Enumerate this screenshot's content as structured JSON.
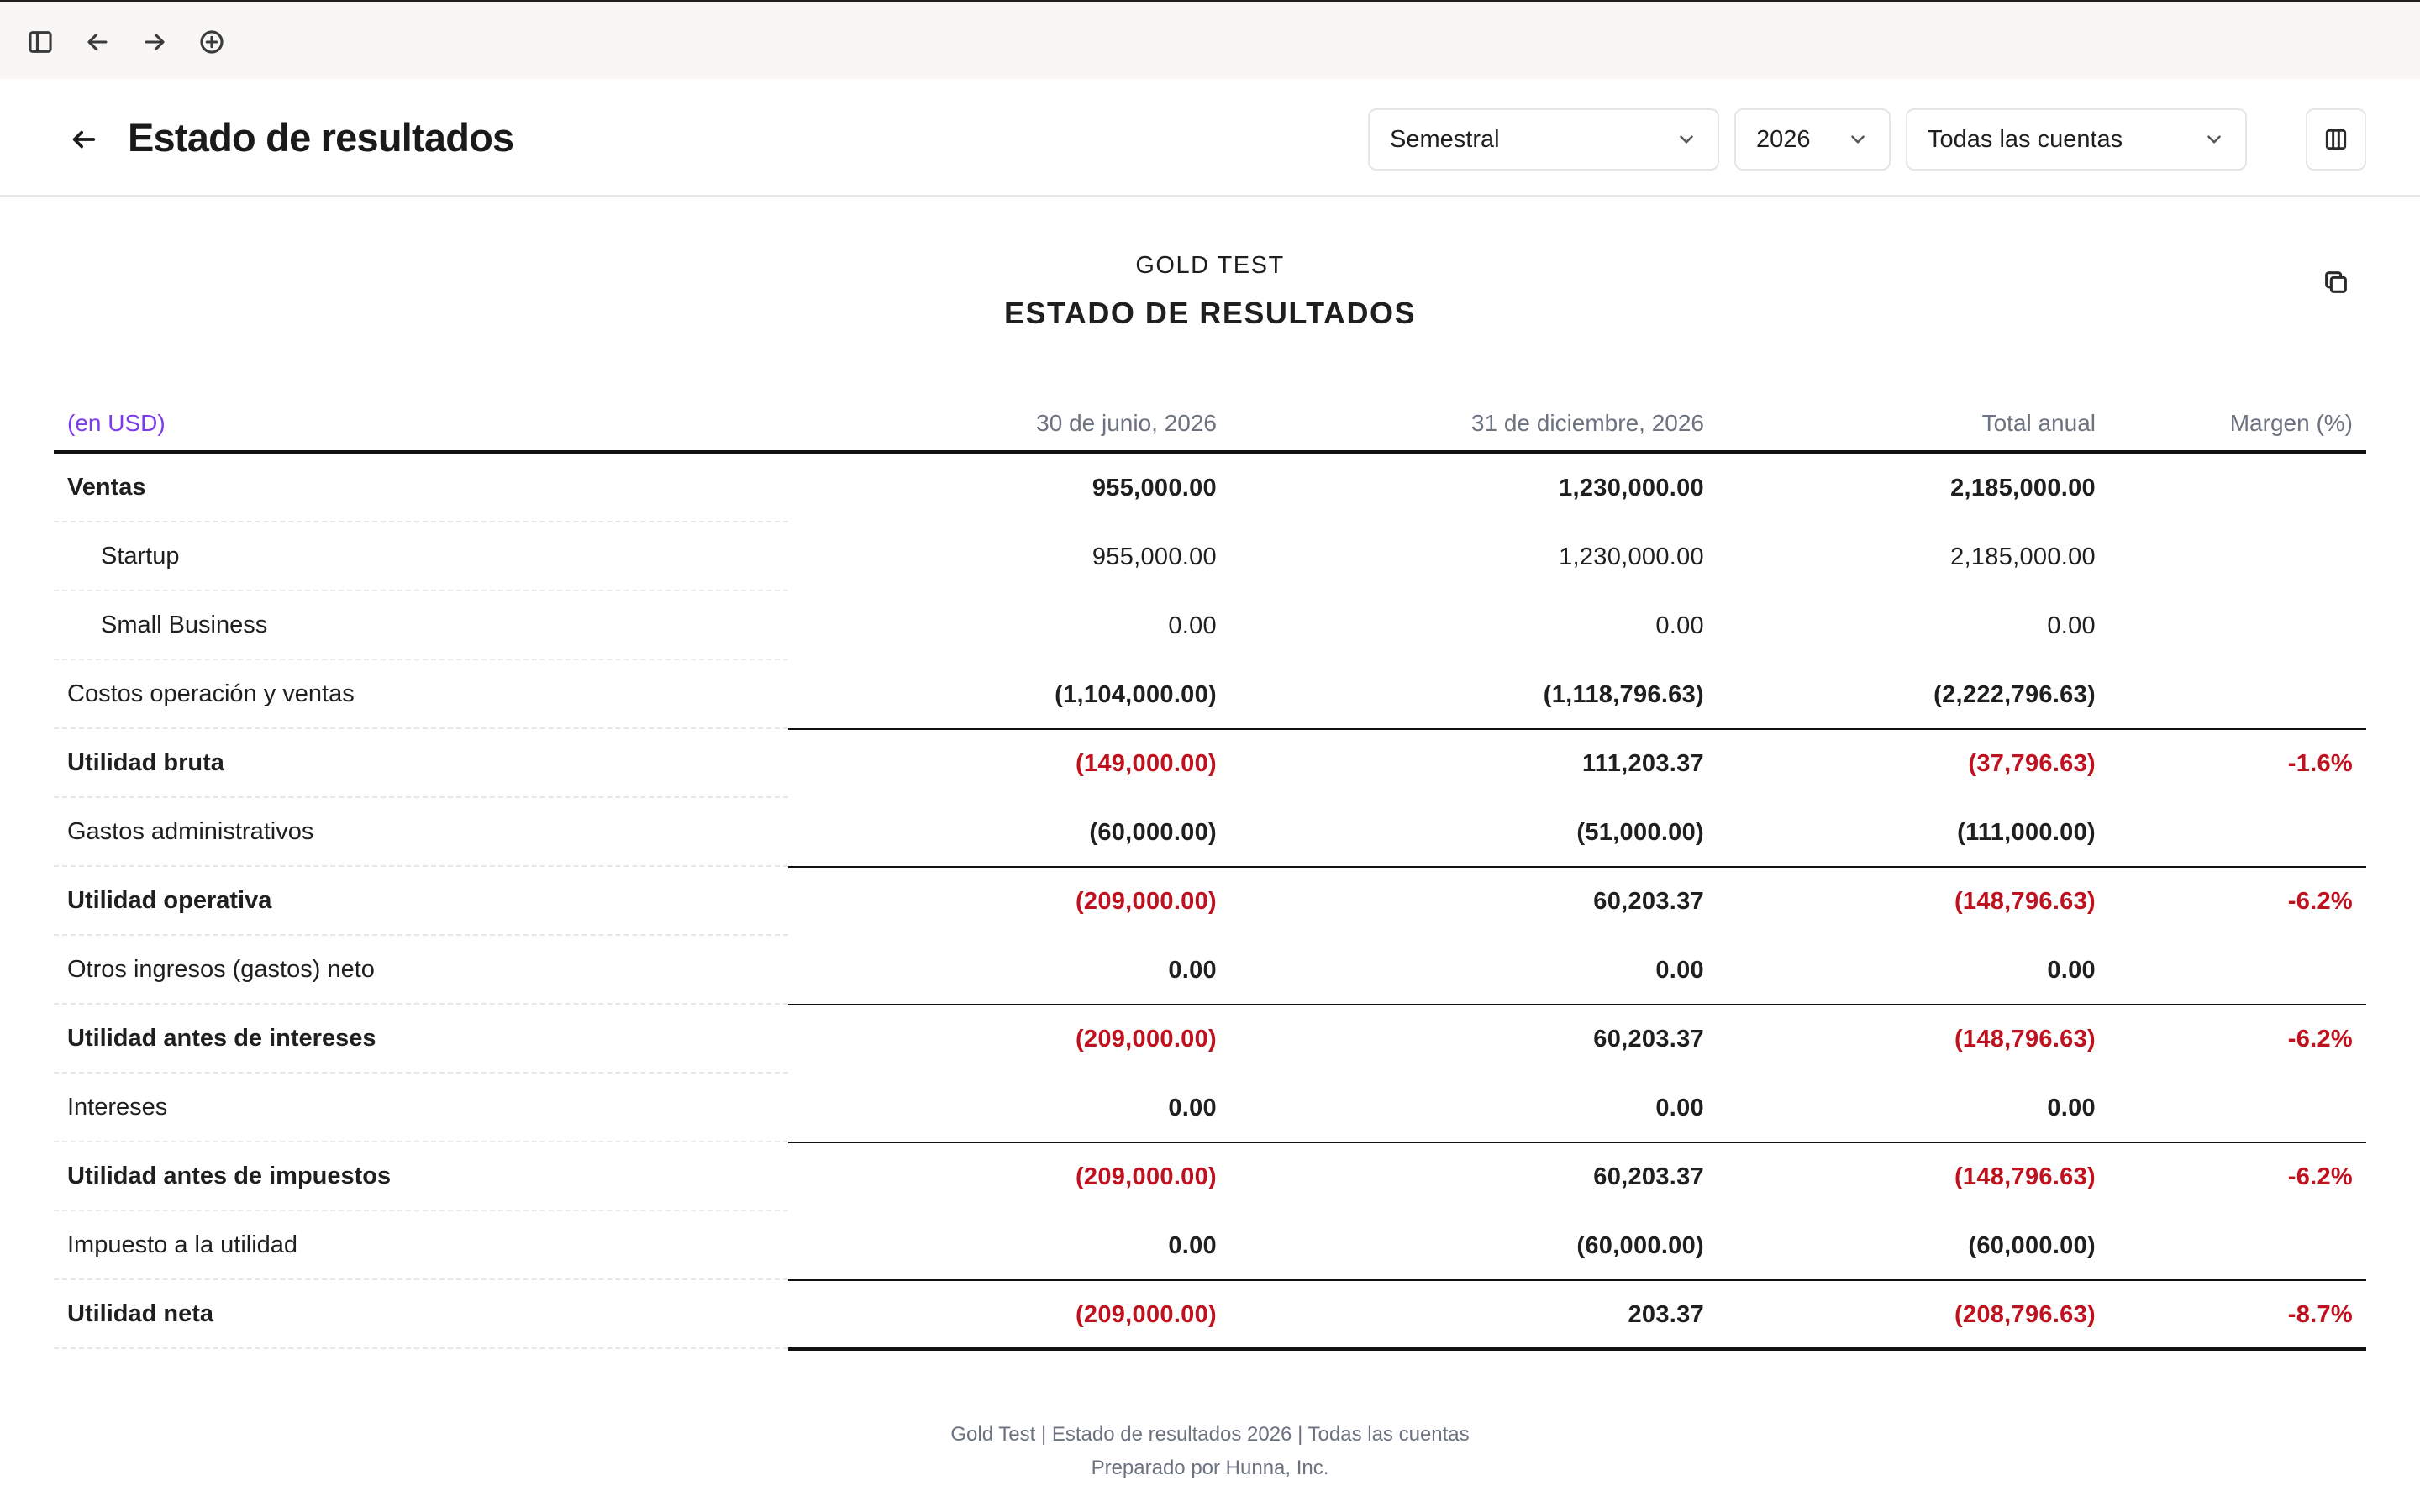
{
  "topbar": {
    "icons": [
      "sidebar-toggle-icon",
      "arrow-left-icon",
      "arrow-right-icon",
      "plus-circle-icon"
    ]
  },
  "header": {
    "title": "Estado de resultados",
    "period_select": "Semestral",
    "year_select": "2026",
    "accounts_select": "Todas las cuentas"
  },
  "report": {
    "company": "GOLD TEST",
    "title": "ESTADO DE RESULTADOS",
    "unit_label": "(en USD)",
    "columns": [
      "30 de junio, 2026",
      "31 de diciembre, 2026",
      "Total anual",
      "Margen (%)"
    ],
    "rows": [
      {
        "label": "Ventas",
        "values": [
          "955,000.00",
          "1,230,000.00",
          "2,185,000.00",
          ""
        ]
      },
      {
        "label": "Startup",
        "values": [
          "955,000.00",
          "1,230,000.00",
          "2,185,000.00",
          ""
        ]
      },
      {
        "label": "Small Business",
        "values": [
          "0.00",
          "0.00",
          "0.00",
          ""
        ]
      },
      {
        "label": "Costos operación y ventas",
        "values": [
          "(1,104,000.00)",
          "(1,118,796.63)",
          "(2,222,796.63)",
          ""
        ]
      },
      {
        "label": "Utilidad bruta",
        "values": [
          "(149,000.00)",
          "111,203.37",
          "(37,796.63)",
          "-1.6%"
        ]
      },
      {
        "label": "Gastos administrativos",
        "values": [
          "(60,000.00)",
          "(51,000.00)",
          "(111,000.00)",
          ""
        ]
      },
      {
        "label": "Utilidad operativa",
        "values": [
          "(209,000.00)",
          "60,203.37",
          "(148,796.63)",
          "-6.2%"
        ]
      },
      {
        "label": "Otros ingresos (gastos) neto",
        "values": [
          "0.00",
          "0.00",
          "0.00",
          ""
        ]
      },
      {
        "label": "Utilidad antes de intereses",
        "values": [
          "(209,000.00)",
          "60,203.37",
          "(148,796.63)",
          "-6.2%"
        ]
      },
      {
        "label": "Intereses",
        "values": [
          "0.00",
          "0.00",
          "0.00",
          ""
        ]
      },
      {
        "label": "Utilidad antes de impuestos",
        "values": [
          "(209,000.00)",
          "60,203.37",
          "(148,796.63)",
          "-6.2%"
        ]
      },
      {
        "label": "Impuesto a la utilidad",
        "values": [
          "0.00",
          "(60,000.00)",
          "(60,000.00)",
          ""
        ]
      },
      {
        "label": "Utilidad neta",
        "values": [
          "(209,000.00)",
          "203.37",
          "(208,796.63)",
          "-8.7%"
        ]
      }
    ]
  },
  "footer": {
    "line1": "Gold Test | Estado de resultados 2026 | Todas las cuentas",
    "line2": "Preparado por Hunna, Inc."
  },
  "colors": {
    "negative": "#c0111f",
    "unit_label": "#7c3aed",
    "muted": "#6b7280"
  }
}
